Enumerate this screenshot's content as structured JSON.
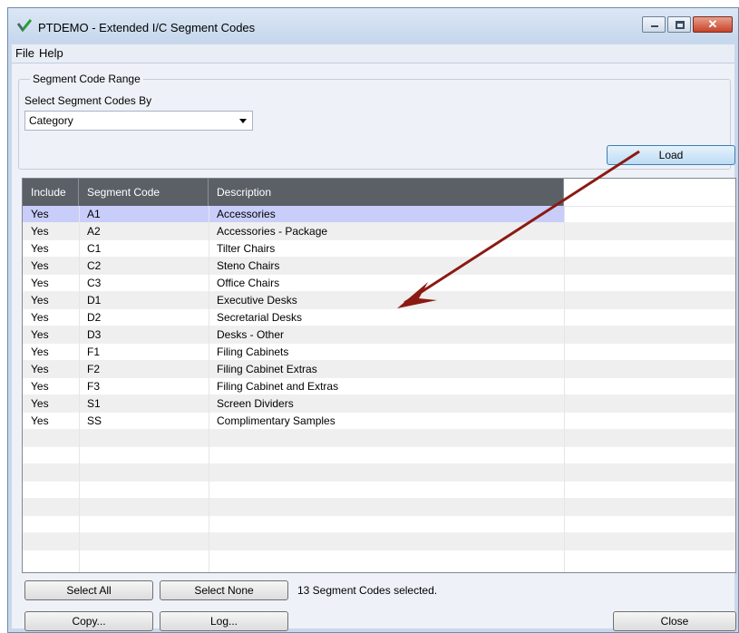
{
  "window": {
    "title": "PTDEMO - Extended I/C Segment Codes"
  },
  "menu": {
    "file": "File",
    "help": "Help"
  },
  "range": {
    "group_label": "Segment Code Range",
    "select_label": "Select Segment Codes By",
    "select_value": "Category",
    "load_label": "Load"
  },
  "grid": {
    "columns": [
      "Include",
      "Segment Code",
      "Description"
    ],
    "rows": [
      {
        "include": "Yes",
        "code": "A1",
        "description": "Accessories"
      },
      {
        "include": "Yes",
        "code": "A2",
        "description": "Accessories - Package"
      },
      {
        "include": "Yes",
        "code": "C1",
        "description": "Tilter Chairs"
      },
      {
        "include": "Yes",
        "code": "C2",
        "description": "Steno Chairs"
      },
      {
        "include": "Yes",
        "code": "C3",
        "description": "Office Chairs"
      },
      {
        "include": "Yes",
        "code": "D1",
        "description": "Executive Desks"
      },
      {
        "include": "Yes",
        "code": "D2",
        "description": "Secretarial Desks"
      },
      {
        "include": "Yes",
        "code": "D3",
        "description": "Desks - Other"
      },
      {
        "include": "Yes",
        "code": "F1",
        "description": "Filing Cabinets"
      },
      {
        "include": "Yes",
        "code": "F2",
        "description": "Filing Cabinet Extras"
      },
      {
        "include": "Yes",
        "code": "F3",
        "description": "Filing Cabinet and Extras"
      },
      {
        "include": "Yes",
        "code": "S1",
        "description": "Screen Dividers"
      },
      {
        "include": "Yes",
        "code": "SS",
        "description": "Complimentary Samples"
      }
    ],
    "selected_index": 0
  },
  "footer": {
    "select_all_label": "Select All",
    "select_none_label": "Select None",
    "status": "13 Segment Codes selected.",
    "copy_label": "Copy...",
    "log_label": "Log...",
    "close_label": "Close"
  },
  "colors": {
    "header_bg": "#5b5f66",
    "selected_row": "#c9cdfa",
    "annotation_arrow": "#8b1a12"
  },
  "icons": {
    "app": "app-logo-icon",
    "minimize": "minimize-icon",
    "maximize": "maximize-icon",
    "close": "close-icon",
    "dropdown": "chevron-down-icon"
  }
}
